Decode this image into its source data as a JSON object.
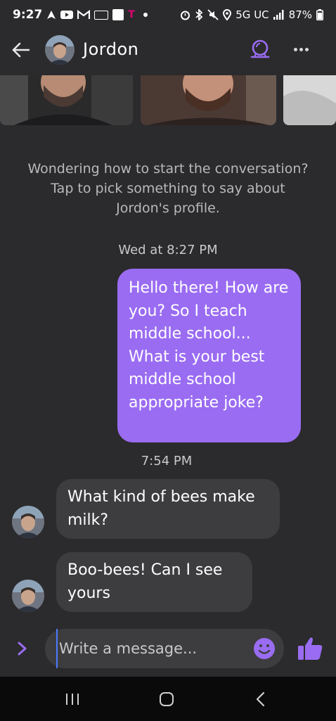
{
  "status_bar": {
    "time": "9:27",
    "network": "5G UC",
    "battery": "87%"
  },
  "header": {
    "contact_name": "Jordon",
    "accent_color": "#9a6cf2"
  },
  "conversation": {
    "prompt": "Wondering how to start the conversation? Tap to pick something to say about Jordon's profile.",
    "messages": [
      {
        "timestamp": "Wed at 8:27 PM",
        "direction": "outgoing",
        "text": "Hello there! How are you? So I teach middle school... What is your best middle school appropriate joke?"
      },
      {
        "timestamp": "7:54 PM",
        "direction": "incoming",
        "text": "What kind of bees make milk?"
      },
      {
        "direction": "incoming",
        "text": "Boo-bees! Can I see yours"
      }
    ]
  },
  "composer": {
    "placeholder": "Write a message..."
  },
  "icons": {
    "back": "arrow-left-icon",
    "video_call": "video-call-icon",
    "more": "more-horizontal-icon",
    "expand": "chevron-right-icon",
    "emoji": "emoji-smile-icon",
    "like": "thumbs-up-icon",
    "nav_recents": "recents-icon",
    "nav_home": "home-icon",
    "nav_back": "nav-back-icon"
  }
}
